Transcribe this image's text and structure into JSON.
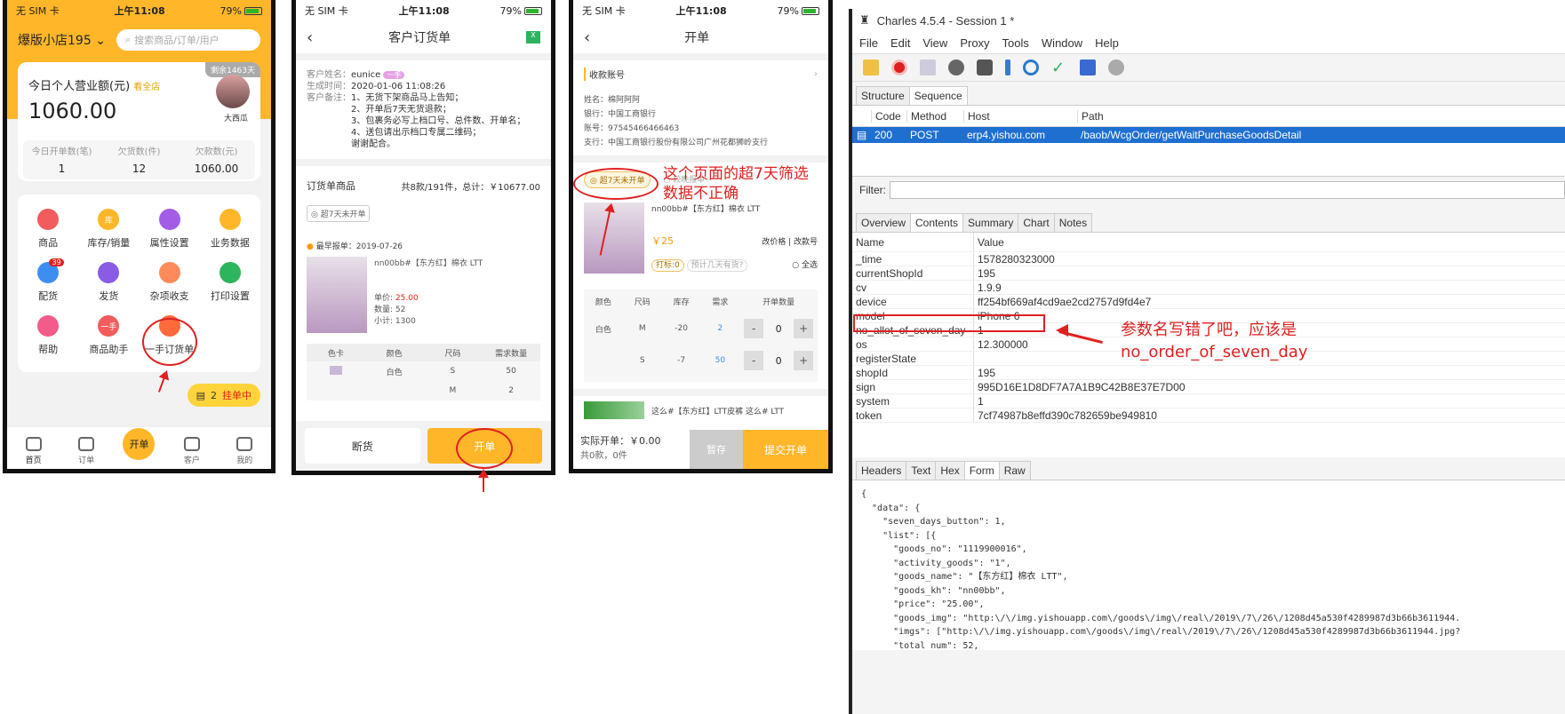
{
  "status_bar": {
    "carrier": "无 SIM 卡",
    "time": "上午11:08",
    "battery": "79%"
  },
  "phone1": {
    "shop": "爆版小店195",
    "search_placeholder": "搜索商品/订单/用户",
    "remaining": "剩余1463天",
    "revenue_label": "今日个人营业额(元)",
    "view_all": "看全店",
    "revenue": "1060.00",
    "avatar_name": "大西瓜",
    "stats": [
      {
        "label": "今日开单数(笔)",
        "value": "1"
      },
      {
        "label": "欠货数(件)",
        "value": "12"
      },
      {
        "label": "欠款数(元)",
        "value": "1060.00"
      }
    ],
    "grid": [
      {
        "label": "商品",
        "icon": "",
        "color": "#f25c5c"
      },
      {
        "label": "库存/销量",
        "icon": "库",
        "color": "#ffb629"
      },
      {
        "label": "属性设置",
        "icon": "",
        "color": "#a35ce6"
      },
      {
        "label": "业务数据",
        "icon": "",
        "color": "#ffb629"
      },
      {
        "label": "配货",
        "icon": "",
        "color": "#3d8ef0",
        "badge": "39"
      },
      {
        "label": "发货",
        "icon": "",
        "color": "#8a5ce6"
      },
      {
        "label": "杂项收支",
        "icon": "",
        "color": "#ff8a5c"
      },
      {
        "label": "打印设置",
        "icon": "",
        "color": "#2db55d"
      },
      {
        "label": "帮助",
        "icon": "",
        "color": "#f25c8a"
      },
      {
        "label": "商品助手",
        "icon": "一手",
        "color": "#f25c5c"
      },
      {
        "label": "一手订货单",
        "icon": "",
        "color": "#ff6a3d"
      }
    ],
    "float_count": "2",
    "float_label": "挂单中",
    "nav": [
      {
        "label": "首页"
      },
      {
        "label": "订单"
      },
      {
        "label": "开单"
      },
      {
        "label": "客户"
      },
      {
        "label": "我的"
      }
    ]
  },
  "phone2": {
    "title": "客户订货单",
    "name_label": "客户姓名：",
    "name": "eunice",
    "name_tag": "一手",
    "time_label": "生成时间：",
    "time": "2020-01-06 11:08:26",
    "remark_label": "客户备注：",
    "remarks": [
      "1、无货下架商品马上告知；",
      "2、开单后7天无货退款；",
      "3、包裹务必写上档口号、总件数、开单名；",
      "4、送包请出示档口专属二维码；",
      "谢谢配合。"
    ],
    "goods_title": "订货单商品",
    "goods_summary": "共8款/191件，总计：￥10677.00",
    "filter_chip": "超7天未开单",
    "earliest": "最早报单：2019-07-26",
    "product_name": "nn00bb#【东方红】棉衣 LTT",
    "price_label": "单价:",
    "price": "25.00",
    "qty_label": "数量:",
    "qty": "52",
    "subtotal_label": "小计:",
    "subtotal": "1300",
    "table_headers": [
      "色卡",
      "颜色",
      "尺码",
      "需求数量"
    ],
    "table_rows": [
      [
        "",
        "白色",
        "S",
        "50"
      ],
      [
        "",
        "",
        "M",
        "2"
      ]
    ],
    "btn_out": "断货",
    "btn_open": "开单"
  },
  "phone3": {
    "title": "开单",
    "account_label": "收款账号",
    "acct_lines": [
      "姓名：棉阿阿阿",
      "银行：中国工商银行",
      "账号：97545466466463",
      "支行：中国工商银行股份有限公司广州花都狮岭支行"
    ],
    "chip1": "超7天未开单",
    "chip2": "较晚报单",
    "product_name": "nn00bb#【东方红】棉衣 LTT",
    "price": "￥25",
    "edit_price": "改价格",
    "edit_code": "改款号",
    "mark": "打标:0",
    "eta": "预计几天有货?",
    "select_all": "全选",
    "headers": [
      "颜色",
      "尺码",
      "库存",
      "需求",
      "开单数量"
    ],
    "rows": [
      {
        "color": "白色",
        "size": "M",
        "stock": "-20",
        "need": "2",
        "qty": "0"
      },
      {
        "color": "",
        "size": "S",
        "stock": "-7",
        "need": "50",
        "qty": "0"
      }
    ],
    "product2": "这么#【东方红】LTT皮裤 这么# LTT",
    "actual_label": "实际开单：￥0.00",
    "count_label": "共0款，0件",
    "btn_save": "暂存",
    "btn_submit": "提交开单"
  },
  "annotations": {
    "a1": "这个页面的超7天筛选",
    "a2": "数据不正确",
    "a3": "参数名写错了吧，应该是",
    "a4": "no_order_of_seven_day"
  },
  "charles": {
    "title": "Charles 4.5.4 - Session 1 *",
    "menu": [
      "File",
      "Edit",
      "View",
      "Proxy",
      "Tools",
      "Window",
      "Help"
    ],
    "tabs_top": [
      "Structure",
      "Sequence"
    ],
    "cols": [
      "Code",
      "Method",
      "Host",
      "Path"
    ],
    "row": {
      "code": "200",
      "method": "POST",
      "host": "erp4.yishou.com",
      "path": "/baob/WcgOrder/getWaitPurchaseGoodsDetail"
    },
    "filter_label": "Filter:",
    "tabs_mid": [
      "Overview",
      "Contents",
      "Summary",
      "Chart",
      "Notes"
    ],
    "name_col": "Name",
    "value_col": "Value",
    "params": [
      {
        "k": "_time",
        "v": "1578280323000"
      },
      {
        "k": "currentShopId",
        "v": "195"
      },
      {
        "k": "cv",
        "v": "1.9.9"
      },
      {
        "k": "device",
        "v": "ff254bf669af4cd9ae2cd2757d9fd4e7"
      },
      {
        "k": "model",
        "v": "iPhone 6"
      },
      {
        "k": "no_allot_of_seven_day",
        "v": "1"
      },
      {
        "k": "os",
        "v": "12.300000"
      },
      {
        "k": "registerState",
        "v": ""
      },
      {
        "k": "shopId",
        "v": "195"
      },
      {
        "k": "sign",
        "v": "995D16E1D8DF7A7A1B9C42B8E37E7D00"
      },
      {
        "k": "system",
        "v": "1"
      },
      {
        "k": "token",
        "v": "7cf74987b8effd390c782659be949810"
      }
    ],
    "tabs_bottom": [
      "Headers",
      "Text",
      "Hex",
      "Form",
      "Raw"
    ],
    "json_lines": [
      "{",
      "  \"data\": {",
      "    \"seven_days_button\": 1,",
      "    \"list\": [{",
      "      \"goods_no\": \"1119900016\",",
      "      \"activity_goods\": \"1\",",
      "      \"goods_name\": \"【东方红】棉衣 LTT\",",
      "      \"goods_kh\": \"nn00bb\",",
      "      \"price\": \"25.00\",",
      "      \"goods_img\": \"http:\\/\\/img.yishouapp.com\\/goods\\/img\\/real\\/2019\\/7\\/26\\/1208d45a530f4289987d3b66b3611944.",
      "      \"imgs\": [\"http:\\/\\/img.yishouapp.com\\/goods\\/img\\/real\\/2019\\/7\\/26\\/1208d45a530f4289987d3b66b3611944.jpg?",
      "      \"total_num\": 52,"
    ]
  }
}
